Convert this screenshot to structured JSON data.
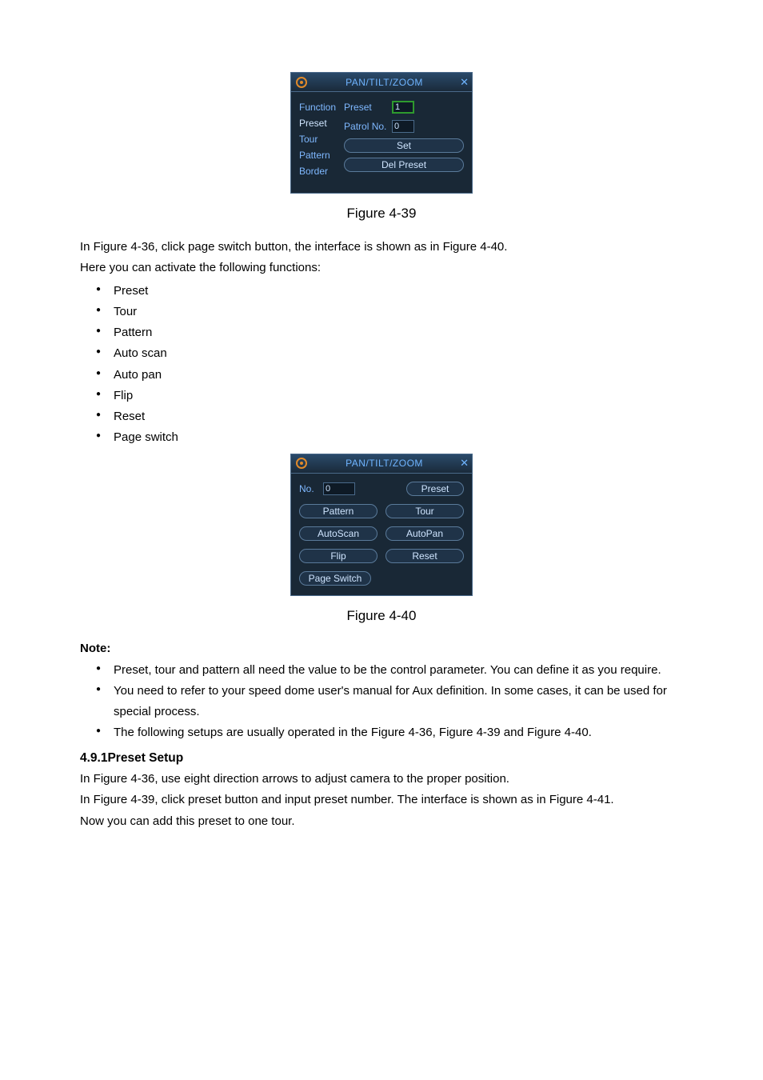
{
  "panel1": {
    "title": "PAN/TILT/ZOOM",
    "funcs": {
      "f0": "Function",
      "f1": "Preset",
      "f2": "Tour",
      "f3": "Pattern",
      "f4": "Border"
    },
    "preset_label": "Preset",
    "preset_val": "1",
    "patrol_label": "Patrol No.",
    "patrol_val": "0",
    "set_btn": "Set",
    "del_btn": "Del Preset"
  },
  "fig39": "Figure 4-39",
  "intro1": "In  Figure 4-36, click page switch button, the interface is shown as in Figure 4-40.",
  "intro2": "Here you can activate the following functions:",
  "feat": {
    "b0": "Preset",
    "b1": "Tour",
    "b2": "Pattern",
    "b3": "Auto scan",
    "b4": "Auto pan",
    "b5": "Flip",
    "b6": "Reset",
    "b7": "Page switch"
  },
  "panel2": {
    "title": "PAN/TILT/ZOOM",
    "no_label": "No.",
    "no_val": "0",
    "preset": "Preset",
    "pattern": "Pattern",
    "tour": "Tour",
    "autoscan": "AutoScan",
    "autopan": "AutoPan",
    "flip": "Flip",
    "reset": "Reset",
    "pageswitch": "Page Switch"
  },
  "fig40": "Figure 4-40",
  "note_head": "Note:",
  "notes": {
    "n0": "Preset, tour and pattern all need the value to be the control parameter. You can define it as you require.",
    "n1": "You need to refer to your speed dome user's manual for Aux definition. In some cases, it can be used for special process.",
    "n2": "The following setups are usually operated in the Figure 4-36, Figure 4-39 and Figure 4-40."
  },
  "section_head": "4.9.1Preset Setup",
  "p1": "In Figure 4-36, use eight direction arrows to adjust camera to the proper position.",
  "p2": "In Figure 4-39, click preset button and input preset number. The interface is shown as in Figure 4-41.",
  "p3": "Now you can add this preset to one tour."
}
